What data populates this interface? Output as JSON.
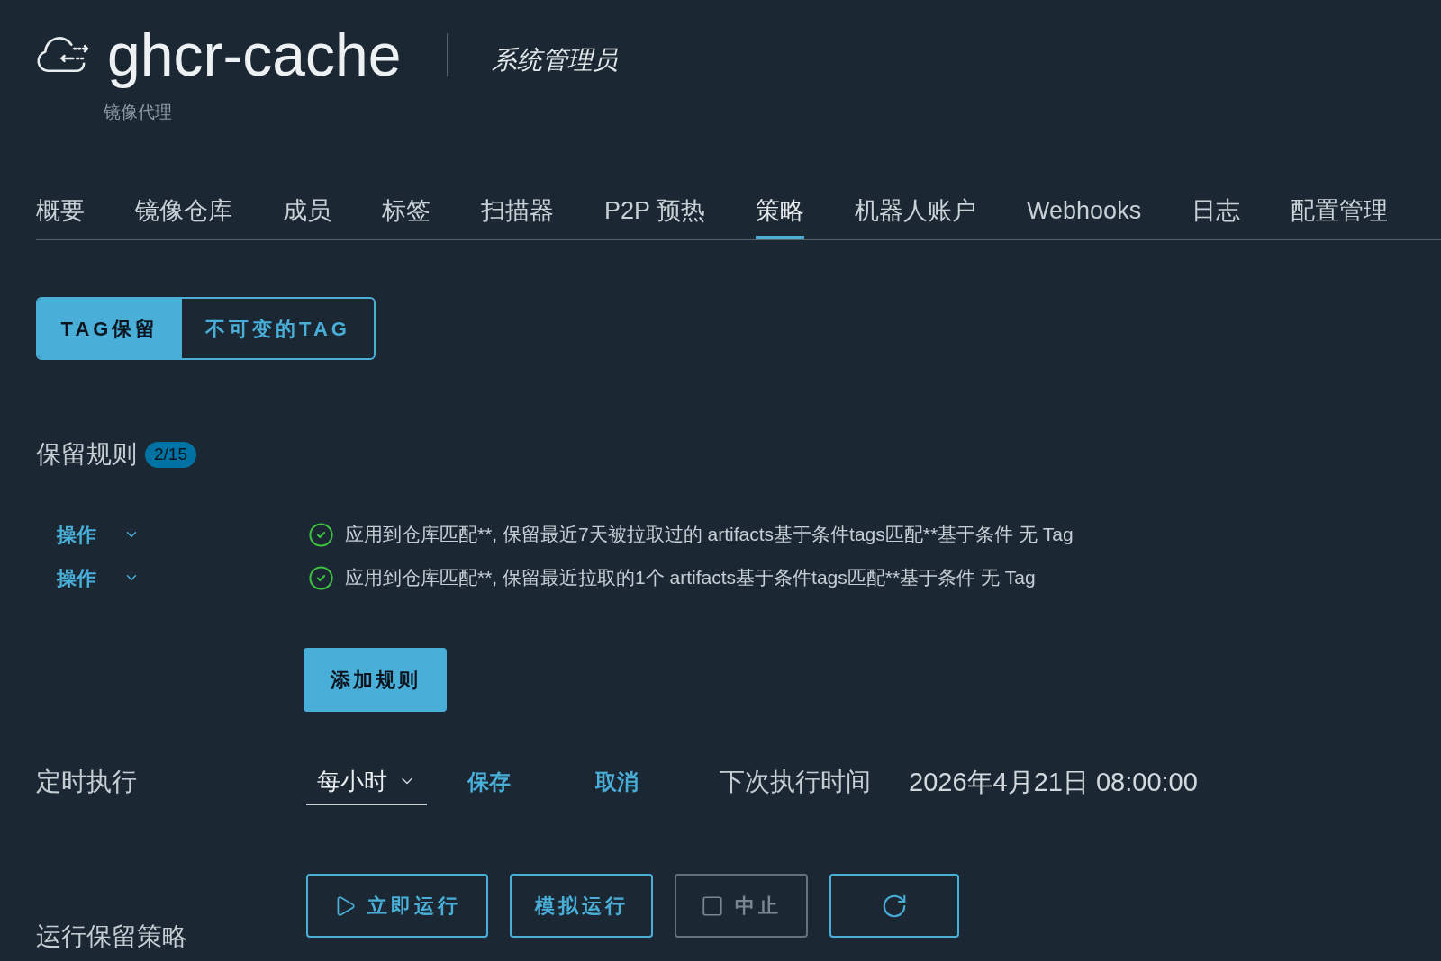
{
  "header": {
    "title": "ghcr-cache",
    "role": "系统管理员",
    "subtitle": "镜像代理"
  },
  "tabs": [
    {
      "label": "概要",
      "selected": false
    },
    {
      "label": "镜像仓库",
      "selected": false
    },
    {
      "label": "成员",
      "selected": false
    },
    {
      "label": "标签",
      "selected": false
    },
    {
      "label": "扫描器",
      "selected": false
    },
    {
      "label": "P2P 预热",
      "selected": false
    },
    {
      "label": "策略",
      "selected": true
    },
    {
      "label": "机器人账户",
      "selected": false
    },
    {
      "label": "Webhooks",
      "selected": false
    },
    {
      "label": "日志",
      "selected": false
    },
    {
      "label": "配置管理",
      "selected": false
    }
  ],
  "segments": [
    {
      "label": "TAG保留",
      "selected": true
    },
    {
      "label": "不可变的TAG",
      "selected": false
    }
  ],
  "retention_rules": {
    "title": "保留规则",
    "count": "2/15",
    "rules": [
      {
        "action": "操作",
        "enabled": true,
        "description": "应用到仓库匹配**, 保留最近7天被拉取过的 artifacts基于条件tags匹配**基于条件 无 Tag"
      },
      {
        "action": "操作",
        "enabled": true,
        "description": "应用到仓库匹配**, 保留最近拉取的1个 artifacts基于条件tags匹配**基于条件 无 Tag"
      }
    ],
    "add_button": "添加规则"
  },
  "schedule": {
    "label": "定时执行",
    "frequency": "每小时",
    "save": "保存",
    "cancel": "取消",
    "next_run_label": "下次执行时间",
    "next_run_time": "2026年4月21日 08:00:00"
  },
  "run_policy": {
    "label": "运行保留策略",
    "buttons": [
      {
        "kind": "run",
        "label": "立即运行",
        "disabled": false
      },
      {
        "kind": "dry_run",
        "label": "模拟运行",
        "disabled": false
      },
      {
        "kind": "abort",
        "label": "中止",
        "disabled": true
      },
      {
        "kind": "refresh",
        "disabled": false
      }
    ]
  }
}
